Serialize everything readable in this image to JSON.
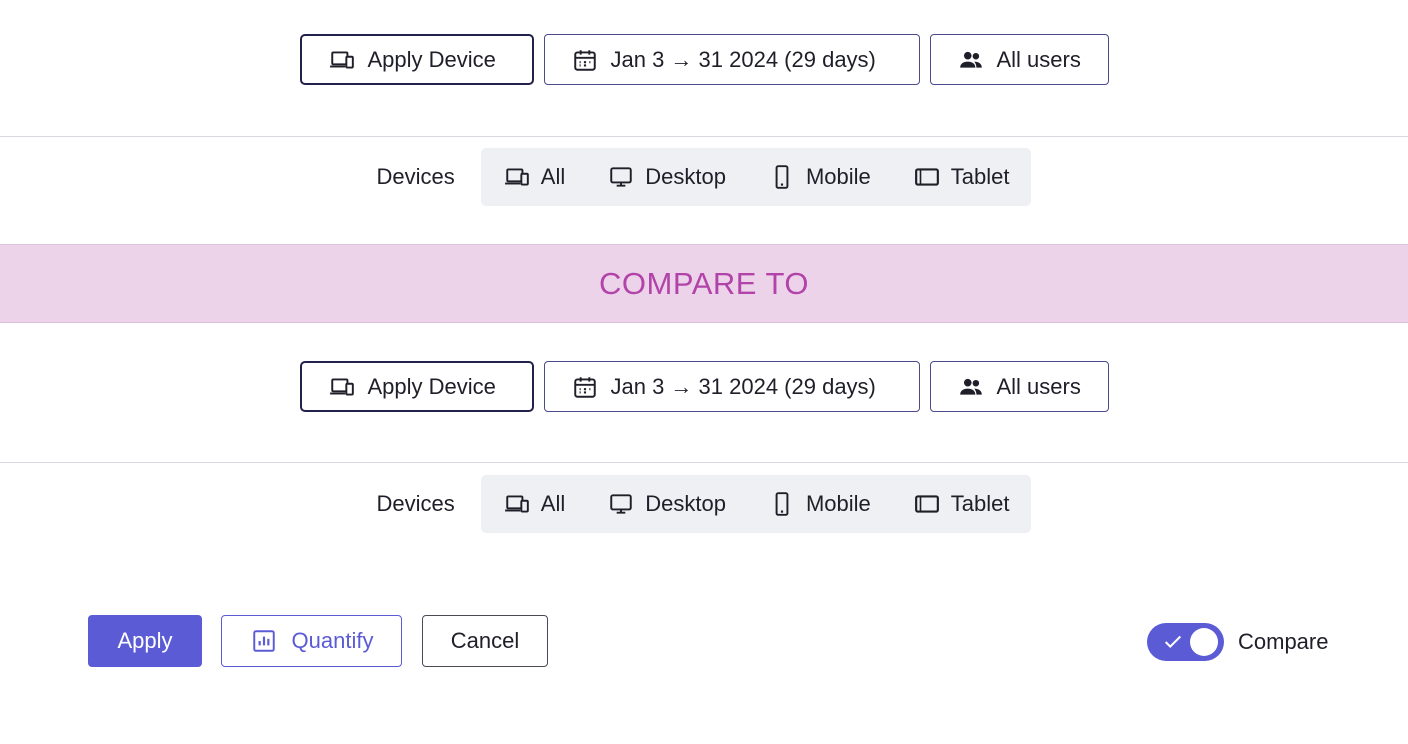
{
  "primary": {
    "filters": {
      "device_label": "Apply Device",
      "date_label": "Jan 3 → 31 2024 (29 days)",
      "users_label": "All users"
    },
    "devices": {
      "label": "Devices",
      "options": [
        {
          "label": "All",
          "icon": "devices-icon"
        },
        {
          "label": "Desktop",
          "icon": "desktop-icon"
        },
        {
          "label": "Mobile",
          "icon": "mobile-icon"
        },
        {
          "label": "Tablet",
          "icon": "tablet-icon"
        }
      ]
    }
  },
  "compare_banner": "COMPARE TO",
  "comparison": {
    "filters": {
      "device_label": "Apply Device",
      "date_label": "Jan 3 → 31 2024 (29 days)",
      "users_label": "All users"
    },
    "devices": {
      "label": "Devices",
      "options": [
        {
          "label": "All",
          "icon": "devices-icon"
        },
        {
          "label": "Desktop",
          "icon": "desktop-icon"
        },
        {
          "label": "Mobile",
          "icon": "mobile-icon"
        },
        {
          "label": "Tablet",
          "icon": "tablet-icon"
        }
      ]
    }
  },
  "footer": {
    "apply_label": "Apply",
    "quantify_label": "Quantify",
    "cancel_label": "Cancel",
    "compare_label": "Compare",
    "compare_enabled": true
  },
  "colors": {
    "accent": "#5b5bd6",
    "banner_bg": "#ecd3ea",
    "banner_text": "#b243a9",
    "segment_bg": "#eff0f4"
  }
}
